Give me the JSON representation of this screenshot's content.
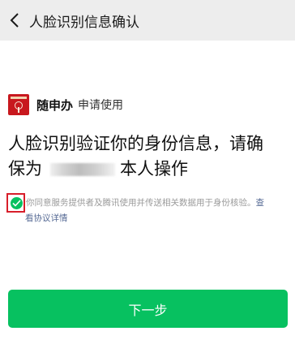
{
  "header": {
    "title": "人脸识别信息确认",
    "back_icon": "chevron-left-icon"
  },
  "app": {
    "logo_icon": "suishenban-logo-icon",
    "name": "随申办",
    "action": "申请使用"
  },
  "headline": {
    "line1": "人脸识别验证你的身份信息，请确",
    "line2_prefix": "保为",
    "line2_suffix": "本人操作"
  },
  "agreement": {
    "checked": true,
    "text": "你同意服务提供者及腾讯使用并传送相关数据用于身份核验。",
    "link_part1": "查",
    "link_part2": "看协议详情"
  },
  "primary_button": {
    "label": "下一步"
  },
  "colors": {
    "nav_bg": "#ededed",
    "accent_green": "#07c160",
    "link_blue": "#576b95",
    "highlight_red": "#d81e2a",
    "logo_red": "#c8181e"
  }
}
